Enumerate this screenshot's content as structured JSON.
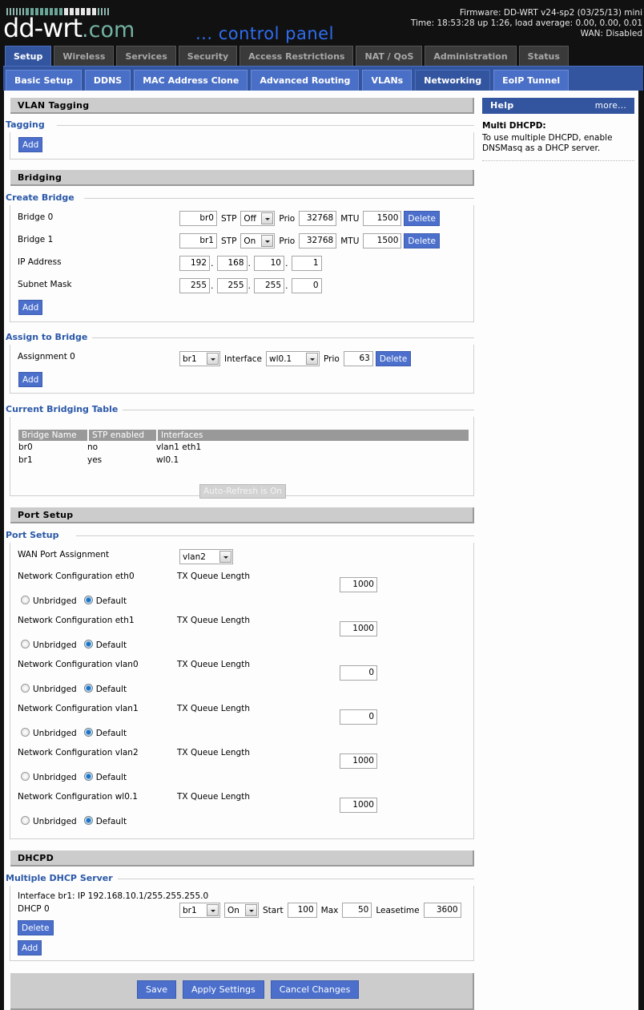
{
  "header": {
    "logo_main": "dd-wrt",
    "logo_domain": ".com",
    "logo_sub": "... control panel",
    "firmware": "Firmware: DD-WRT v24-sp2 (03/25/13) mini",
    "time": "Time: 18:53:28 up 1:26, load average: 0.00, 0.00, 0.01",
    "wan": "WAN: Disabled"
  },
  "main_tabs": [
    {
      "label": "Setup",
      "active": true
    },
    {
      "label": "Wireless"
    },
    {
      "label": "Services"
    },
    {
      "label": "Security"
    },
    {
      "label": "Access Restrictions"
    },
    {
      "label": "NAT / QoS"
    },
    {
      "label": "Administration"
    },
    {
      "label": "Status"
    }
  ],
  "sub_tabs": [
    {
      "label": "Basic Setup"
    },
    {
      "label": "DDNS"
    },
    {
      "label": "MAC Address Clone"
    },
    {
      "label": "Advanced Routing"
    },
    {
      "label": "VLANs"
    },
    {
      "label": "Networking",
      "active": true
    },
    {
      "label": "EoIP Tunnel"
    }
  ],
  "vlan_tagging": {
    "section_title": "VLAN Tagging",
    "legend": "Tagging",
    "add_label": "Add"
  },
  "bridging": {
    "section_title": "Bridging",
    "create_bridge": {
      "legend": "Create Bridge",
      "bridges": [
        {
          "label": "Bridge 0",
          "name": "br0",
          "stp_label": "STP",
          "stp": "Off",
          "prio_label": "Prio",
          "prio": "32768",
          "mtu_label": "MTU",
          "mtu": "1500",
          "delete_label": "Delete"
        },
        {
          "label": "Bridge 1",
          "name": "br1",
          "stp_label": "STP",
          "stp": "On",
          "prio_label": "Prio",
          "prio": "32768",
          "mtu_label": "MTU",
          "mtu": "1500",
          "delete_label": "Delete"
        }
      ],
      "ip_label": "IP Address",
      "ip": [
        "192",
        "168",
        "10",
        "1"
      ],
      "mask_label": "Subnet Mask",
      "mask": [
        "255",
        "255",
        "255",
        "0"
      ],
      "add_label": "Add"
    },
    "assign": {
      "legend": "Assign to Bridge",
      "label": "Assignment 0",
      "bridge": "br1",
      "interface_label": "Interface",
      "interface": "wl0.1",
      "prio_label": "Prio",
      "prio": "63",
      "delete_label": "Delete",
      "add_label": "Add"
    },
    "table": {
      "legend": "Current Bridging Table",
      "headers": [
        "Bridge Name",
        "STP enabled",
        "Interfaces"
      ],
      "rows": [
        [
          "br0",
          "no",
          "vlan1 eth1"
        ],
        [
          "br1",
          "yes",
          "wl0.1"
        ]
      ],
      "auto_refresh_label": "Auto-Refresh is On"
    }
  },
  "port_setup": {
    "section_title": "Port Setup",
    "legend": "Port Setup",
    "wan_label": "WAN Port Assignment",
    "wan_value": "vlan2",
    "tx_label": "TX Queue Length",
    "unbridged_label": "Unbridged",
    "default_label": "Default",
    "interfaces": [
      {
        "label": "Network Configuration eth0",
        "tx": "1000",
        "mode": "Default"
      },
      {
        "label": "Network Configuration eth1",
        "tx": "1000",
        "mode": "Default"
      },
      {
        "label": "Network Configuration vlan0",
        "tx": "0",
        "mode": "Default"
      },
      {
        "label": "Network Configuration vlan1",
        "tx": "0",
        "mode": "Default"
      },
      {
        "label": "Network Configuration vlan2",
        "tx": "1000",
        "mode": "Default"
      },
      {
        "label": "Network Configuration wl0.1",
        "tx": "1000",
        "mode": "Default"
      }
    ]
  },
  "dhcpd": {
    "section_title": "DHCPD",
    "legend": "Multiple DHCP Server",
    "interface_info": "Interface br1: IP 192.168.10.1/255.255.255.0",
    "label": "DHCP 0",
    "bridge": "br1",
    "state": "On",
    "start_label": "Start",
    "start": "100",
    "max_label": "Max",
    "max": "50",
    "lease_label": "Leasetime",
    "lease": "3600",
    "delete_label": "Delete",
    "add_label": "Add"
  },
  "footer": {
    "save_label": "Save",
    "apply_label": "Apply Settings",
    "cancel_label": "Cancel Changes"
  },
  "help": {
    "title": "Help",
    "more_label": "more...",
    "heading": "Multi DHCPD:",
    "text": "To use multiple DHCPD, enable DNSMasq as a DHCP server."
  }
}
